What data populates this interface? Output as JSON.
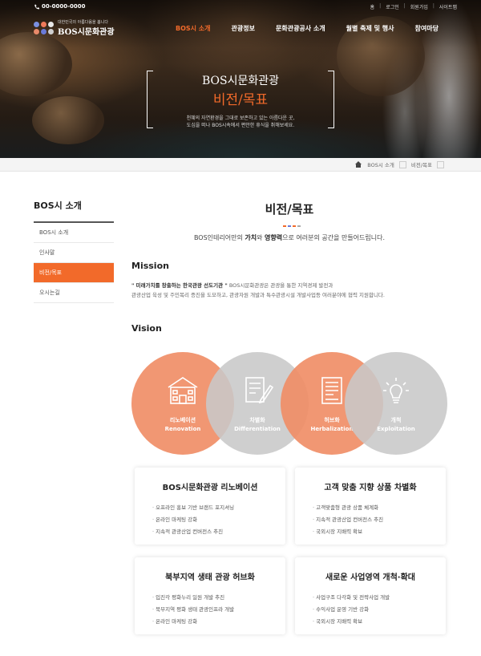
{
  "header": {
    "phone": "00-0000-0000",
    "util_links": [
      "홈",
      "로그인",
      "회원가입",
      "사이트맵"
    ],
    "logo_sub": "대한민국의 아름다움을 봅니다",
    "logo_main": "BOS시문화관광",
    "logo_dot_colors": [
      "#7a8fe0",
      "#f07a5a",
      "#e8e8e8",
      "#e88a6a",
      "#6a7ad8",
      "#cfcfcf"
    ],
    "nav": [
      "BOS시 소개",
      "관광정보",
      "문화관광공사 소개",
      "월별 축제 및 행사",
      "참여마당"
    ]
  },
  "hero": {
    "title": "BOS시문화관광",
    "subtitle": "비전/목표",
    "desc_line1": "천혜의 자연환경을 그대로 보존하고 있는 아름다운 곳,",
    "desc_line2": "도심을 떠나 BOS시속에서 편안한 휴식을 취해보세요."
  },
  "breadcrumb": [
    "BOS시 소개",
    "비전/목표"
  ],
  "sidebar": {
    "title": "BOS시 소개",
    "items": [
      "BOS시 소개",
      "인사말",
      "비전/목표",
      "오시는길"
    ]
  },
  "content": {
    "title": "비전/목표",
    "title_dot_colors": [
      "#f26a2a",
      "#6a7ad8",
      "#f26a2a",
      "#aaaaaa"
    ],
    "lead_pre": "BOS인테리어만의 ",
    "lead_b1": "가치",
    "lead_mid": "와 ",
    "lead_b2": "영향력",
    "lead_post": "으로 여러분의 공간을 만들어드립니다.",
    "mission_heading": "Mission",
    "mission_bold": "\" 미래가치를 창출하는 한국관광 선도기관 \"",
    "mission_line1": " BOS시문화관광은 관광을 통한 지역경제 발전과",
    "mission_line2": "관광산업 육성 및 주민복리 증진을 도모하고, 관광자원 개발과 특수관광시설 개발사업등 여러분야에 협력 지원합니다.",
    "vision_heading": "Vision",
    "vision_circles": [
      {
        "ko": "리노베이션",
        "en": "Renovation"
      },
      {
        "ko": "차별화",
        "en": "Differentiation"
      },
      {
        "ko": "허브화",
        "en": "Herbalization"
      },
      {
        "ko": "개척",
        "en": "Exploitation"
      }
    ],
    "cards": [
      {
        "title": "BOS시문화관광 리노베이션",
        "items": [
          "오프라인 홍보 기반 브랜드 포지셔닝",
          "온라인 마케팅 강화",
          "지속적 관광산업 컨버전스 추진"
        ]
      },
      {
        "title": "고객 맞춤 지향 상품 차별화",
        "items": [
          "고객맞춤형 관광 상품 체계화",
          "지속적 관광산업 컨버전스 추진",
          "국외시장 지배력 확보"
        ]
      },
      {
        "title": "북부지역 생태 관광 허브화",
        "items": [
          "입진각 평화누리 일원 개발 추진",
          "북부지역 평화 생태 관광인프라 개발",
          "온라인 마케팅 강화"
        ]
      },
      {
        "title": "새로운 사업영역 개척·확대",
        "items": [
          "사업구조 다각화 및 전략사업 개발",
          "수익사업 운영 기반 강화",
          "국외시장 지배력 확보"
        ]
      }
    ]
  },
  "colors": {
    "accent": "#f26a2a",
    "circle_orange": "#f08c64",
    "circle_gray": "#c8c8c8"
  }
}
